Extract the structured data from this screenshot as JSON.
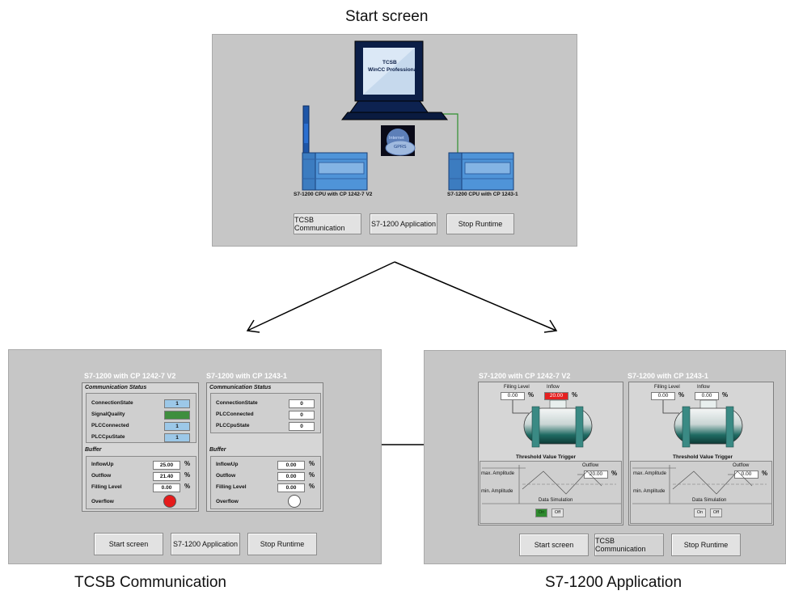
{
  "captions": {
    "start_screen": "Start screen",
    "tcsb_communication": "TCSB Communication",
    "s7_application": "S7-1200 Application"
  },
  "start_screen": {
    "monitor_line1": "TCSB",
    "monitor_line2": "WinCC Professional",
    "cloud_label_1": "Internet",
    "cloud_label_2": "GPRS",
    "plc_left_label": "S7-1200 CPU with CP 1242-7 V2",
    "plc_right_label": "S7-1200 CPU with CP 1243-1",
    "buttons": {
      "tcsb": "TCSB Communication",
      "app": "S7-1200 Application",
      "stop": "Stop Runtime"
    }
  },
  "tcsb_screen": {
    "left_header": "S7-1200 with CP 1242-7 V2",
    "right_header": "S7-1200 with CP 1243-1",
    "comm_status_title": "Communication Status",
    "buffer_title": "Buffer",
    "left_comm": [
      {
        "label": "ConnectionState",
        "value": "1"
      },
      {
        "label": "SignalQuality",
        "value": "20"
      },
      {
        "label": "PLCConnected",
        "value": "1"
      },
      {
        "label": "PLCCpuState",
        "value": "1"
      }
    ],
    "right_comm": [
      {
        "label": "ConnectionState",
        "value": "0"
      },
      {
        "label": "PLCConnected",
        "value": "0"
      },
      {
        "label": "PLCCpuState",
        "value": "0"
      }
    ],
    "left_buffer": [
      {
        "label": "InflowUp",
        "value": "25.00",
        "unit": "%"
      },
      {
        "label": "Outflow",
        "value": "21.40",
        "unit": "%"
      },
      {
        "label": "Filling Level",
        "value": "0.00",
        "unit": "%"
      }
    ],
    "right_buffer": [
      {
        "label": "InflowUp",
        "value": "0.00",
        "unit": "%"
      },
      {
        "label": "Outflow",
        "value": "0.00",
        "unit": "%"
      },
      {
        "label": "Filling Level",
        "value": "0.00",
        "unit": "%"
      }
    ],
    "overflow_label": "Overflow",
    "left_overflow_color": "#e51b1b",
    "right_overflow_color": "#ffffff",
    "buttons": {
      "start": "Start screen",
      "app": "S7-1200 Application",
      "stop": "Stop Runtime"
    }
  },
  "app_screen": {
    "left_header": "S7-1200 with CP 1242-7 V2",
    "right_header": "S7-1200 with CP 1243-1",
    "filling_level_label": "Filling Level",
    "inflow_label": "Inflow",
    "threshold_label": "Threshold Value Trigger",
    "outflow_label": "Outflow",
    "max_amp_label": "max. Amplitude",
    "min_amp_label": "min. Amplitude",
    "data_sim_label": "Data Simulation",
    "on_label": "On",
    "off_label": "Off",
    "unit": "%",
    "left": {
      "filling_level": "0.00",
      "inflow": "20.00",
      "outflow": "20.00"
    },
    "right": {
      "filling_level": "0.00",
      "inflow": "0.00",
      "outflow": "0.00"
    },
    "buttons": {
      "start": "Start screen",
      "tcsb": "TCSB Communication",
      "stop": "Stop Runtime"
    }
  }
}
